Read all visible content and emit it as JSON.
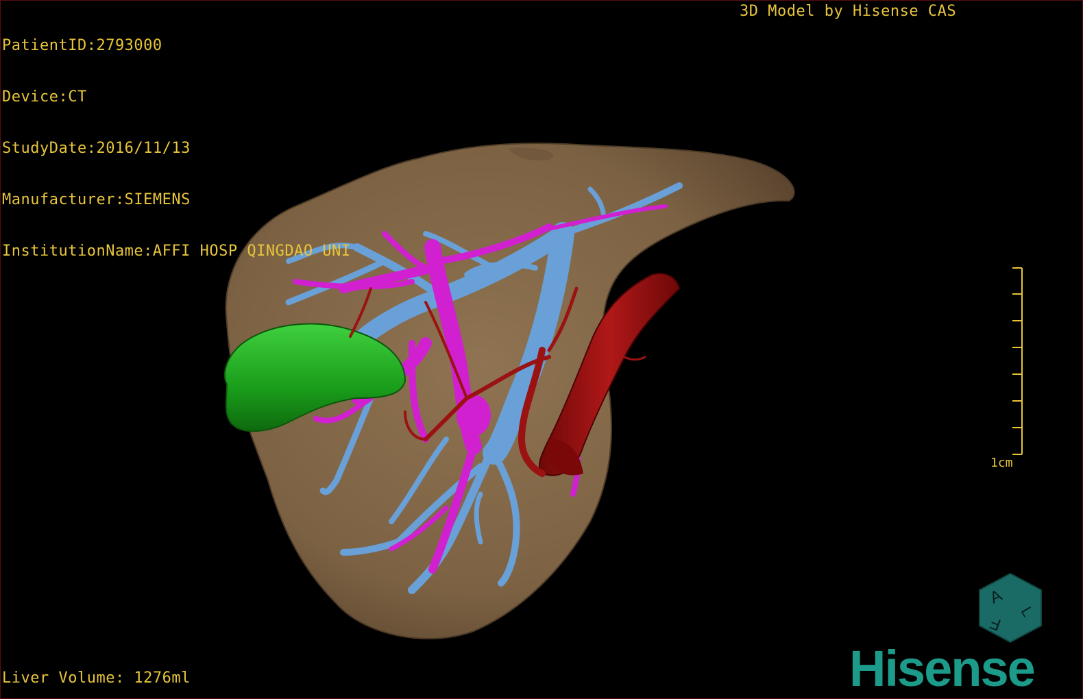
{
  "patient_info": [
    "PatientID:2793000",
    "Device:CT",
    "StudyDate:2016/11/13",
    "Manufacturer:SIEMENS",
    "InstitutionName:AFFI HOSP QINGDAO UNI"
  ],
  "credit": "3D Model by Hisense CAS",
  "liver_volume": "Liver Volume: 1276ml",
  "scale_bar": {
    "label": "1cm"
  },
  "orientation_cube": {
    "letters": [
      "A",
      "F",
      "L"
    ]
  },
  "brand": {
    "logo_text": "Hisense"
  },
  "colors": {
    "overlay_text": "#e8c53a",
    "liver": "#8a6e4c",
    "gallbladder": "#1ea61e",
    "portal_vein": "#6aa0d8",
    "hepatic_vein": "#d020d0",
    "artery": "#9a1212",
    "brand": "#1c9b8b"
  }
}
